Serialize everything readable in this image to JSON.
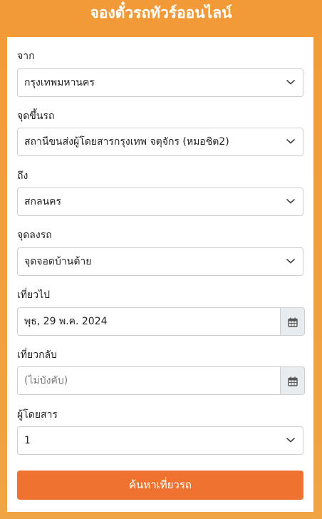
{
  "header": {
    "title": "จองตั๋วรถทัวร์ออนไลน์"
  },
  "form": {
    "from": {
      "label": "จาก",
      "value": "กรุงเทพมหานคร"
    },
    "pickup": {
      "label": "จุดขึ้นรถ",
      "value": "สถานีขนส่งผู้โดยสารกรุงเทพ จตุจักร (หมอชิต2)"
    },
    "to": {
      "label": "ถึง",
      "value": "สกลนคร"
    },
    "dropoff": {
      "label": "จุดลงรถ",
      "value": "จุดจอดบ้านต้าย"
    },
    "depart": {
      "label": "เที่ยวไป",
      "value": "พุธ, 29 พ.ค. 2024"
    },
    "return": {
      "label": "เที่ยวกลับ",
      "placeholder": "(ไม่บังคับ)"
    },
    "passengers": {
      "label": "ผู้โดยสาร",
      "value": "1"
    },
    "search_label": "ค้นหาเที่ยวรถ"
  },
  "icons": {
    "select_arrow": "chevron-down-icon",
    "date_picker": "calendar-icon"
  },
  "colors": {
    "background": "#f29a38",
    "button": "#ef7230"
  }
}
